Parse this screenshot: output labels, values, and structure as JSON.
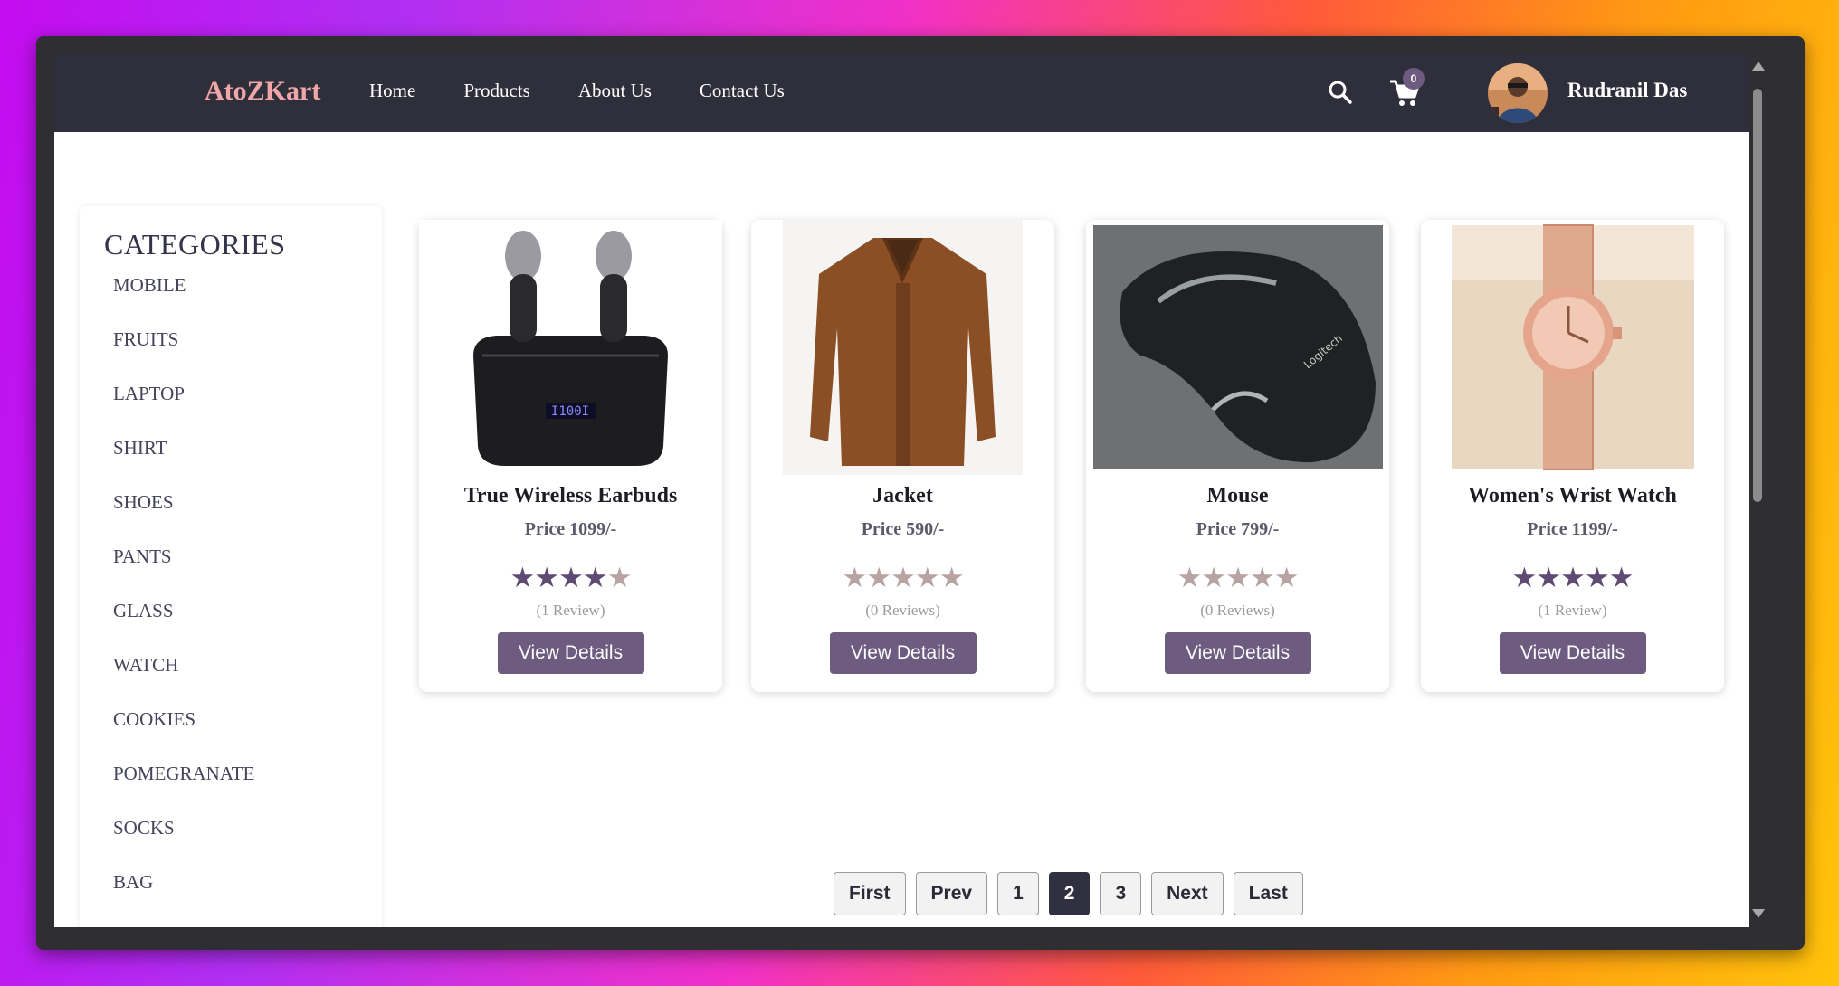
{
  "navbar": {
    "brand": "AtoZKart",
    "links": [
      "Home",
      "Products",
      "About Us",
      "Contact Us"
    ],
    "cart_count": "0",
    "user_name": "Rudranil Das"
  },
  "sidebar": {
    "title": "CATEGORIES",
    "categories": [
      "MOBILE",
      "FRUITS",
      "LAPTOP",
      "SHIRT",
      "SHOES",
      "PANTS",
      "GLASS",
      "WATCH",
      "COOKIES",
      "POMEGRANATE",
      "SOCKS",
      "BAG"
    ]
  },
  "products": [
    {
      "name": "True Wireless Earbuds",
      "price": "Price 1099/-",
      "rating": 4,
      "rating_max": 5,
      "reviews": "(1 Review)",
      "button": "View Details"
    },
    {
      "name": "Jacket",
      "price": "Price 590/-",
      "rating": 0,
      "rating_max": 5,
      "reviews": "(0 Reviews)",
      "button": "View Details"
    },
    {
      "name": "Mouse",
      "price": "Price 799/-",
      "rating": 0,
      "rating_max": 5,
      "reviews": "(0 Reviews)",
      "button": "View Details"
    },
    {
      "name": "Women's Wrist Watch",
      "price": "Price 1199/-",
      "rating": 5,
      "rating_max": 5,
      "reviews": "(1 Review)",
      "button": "View Details"
    }
  ],
  "pagination": {
    "buttons": [
      "First",
      "Prev",
      "1",
      "2",
      "3",
      "Next",
      "Last"
    ],
    "active": "2"
  },
  "colors": {
    "navbar_bg": "#2f2f3c",
    "brand": "#f0a6a6",
    "accent": "#6e5c80",
    "star_filled": "#5e4a73",
    "star_empty": "#b8a3a3"
  }
}
